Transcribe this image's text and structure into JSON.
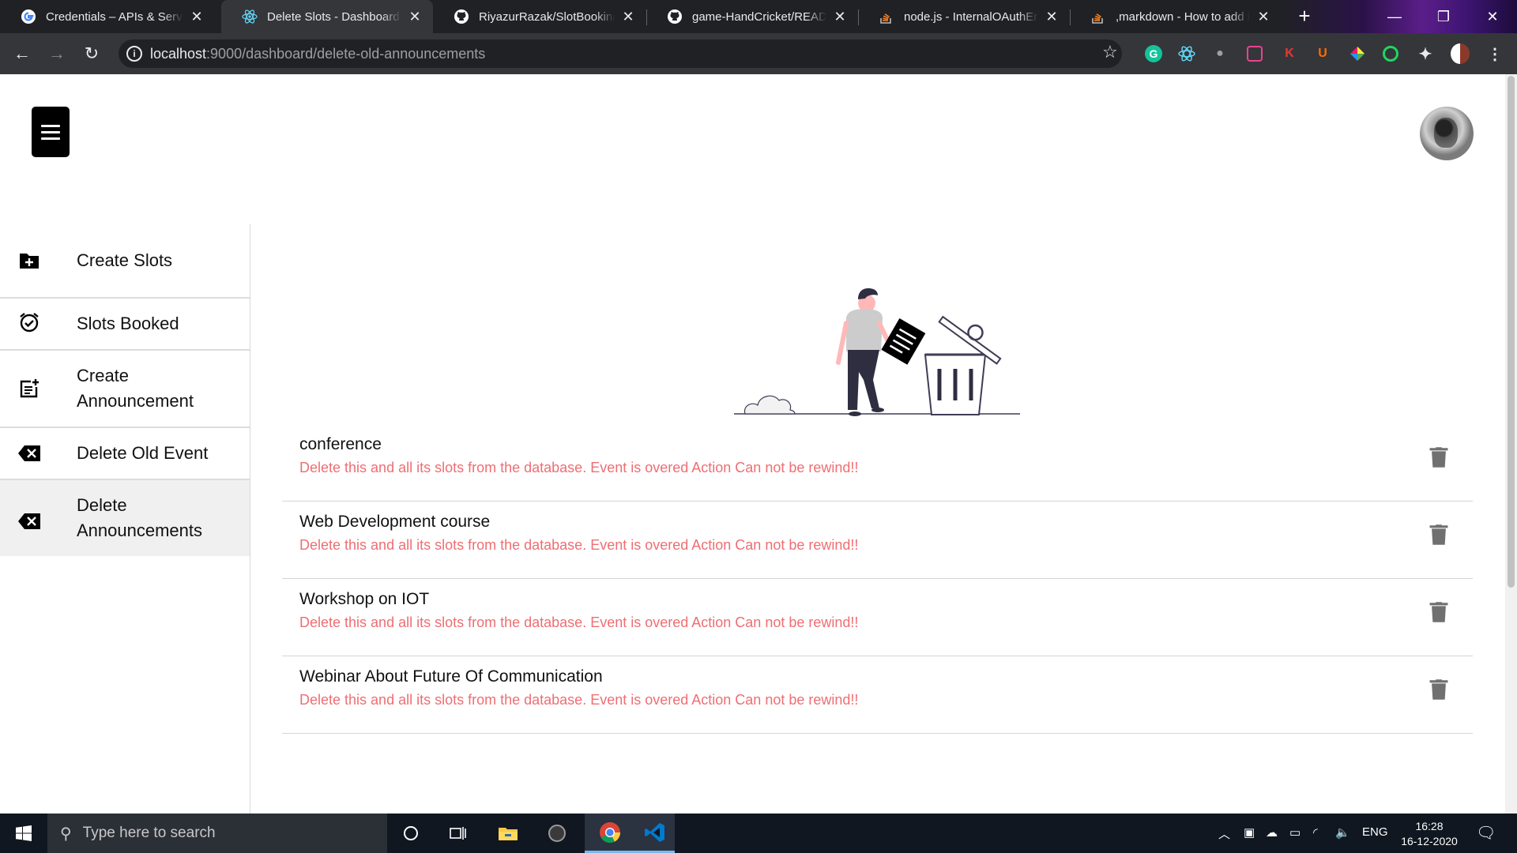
{
  "browser": {
    "tabs": [
      {
        "title": "Credentials – APIs & Services",
        "icon": "google-icon"
      },
      {
        "title": "Delete Slots - Dashboard",
        "icon": "react-icon",
        "active": true
      },
      {
        "title": "RiyazurRazak/SlotBookingApp",
        "icon": "github-icon"
      },
      {
        "title": "game-HandCricket/README.md",
        "icon": "github-icon"
      },
      {
        "title": "node.js - InternalOAuthError",
        "icon": "stackoverflow-icon"
      },
      {
        "title": ",markdown - How to add images",
        "icon": "stackoverflow-icon"
      }
    ],
    "url_host": "localhost",
    "url_rest": ":9000/dashboard/delete-old-announcements"
  },
  "sidebar": {
    "items": [
      {
        "label": "Create Slots",
        "icon": "create-folder-icon"
      },
      {
        "label": "Slots Booked",
        "icon": "alarm-check-icon"
      },
      {
        "label": "Create Announcement",
        "icon": "post-add-icon"
      },
      {
        "label": "Delete Old Event",
        "icon": "backspace-icon"
      },
      {
        "label": "Delete Announcements",
        "icon": "backspace-icon",
        "selected": true
      }
    ]
  },
  "announcements": [
    {
      "title": "conference",
      "warning": "Delete this and all its slots from the database. Event is overed Action Can not be rewind!!"
    },
    {
      "title": "Web Development course",
      "warning": "Delete this and all its slots from the database. Event is overed Action Can not be rewind!!"
    },
    {
      "title": "Workshop on IOT",
      "warning": "Delete this and all its slots from the database. Event is overed Action Can not be rewind!!"
    },
    {
      "title": "Webinar About Future Of Communication",
      "warning": "Delete this and all its slots from the database. Event is overed Action Can not be rewind!!"
    }
  ],
  "taskbar": {
    "search_placeholder": "Type here to search",
    "language": "ENG",
    "time": "16:28",
    "date": "16-12-2020"
  },
  "colors": {
    "warning_text": "#ee6e73",
    "chrome_dark": "#202124"
  }
}
